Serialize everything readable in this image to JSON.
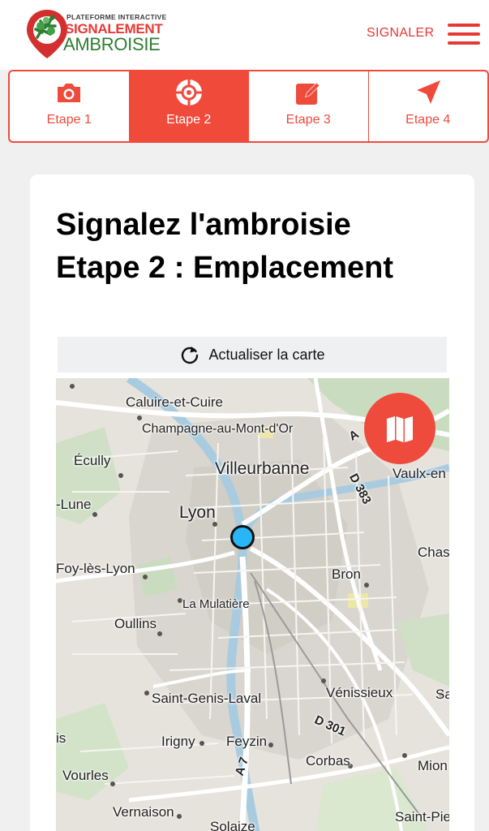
{
  "header": {
    "logo_small": "PLATEFORME INTERACTIVE",
    "logo_line1": "SIGNALEMENT",
    "logo_line2": "AMBROISIE",
    "signaler_label": "SIGNALER",
    "menu_icon": "hamburger-icon"
  },
  "steps": [
    {
      "label": "Etape 1",
      "icon": "camera-icon",
      "active": false
    },
    {
      "label": "Etape 2",
      "icon": "crosshair-icon",
      "active": true
    },
    {
      "label": "Etape 3",
      "icon": "edit-icon",
      "active": false
    },
    {
      "label": "Etape 4",
      "icon": "send-icon",
      "active": false
    }
  ],
  "card": {
    "title_line1": "Signalez l'ambroisie",
    "title_line2": "Etape 2 : Emplacement",
    "refresh_label": "Actualiser la carte"
  },
  "map": {
    "places": {
      "caluire": "Caluire-et-Cuire",
      "champagne": "Champagne-au-Mont-d'Or",
      "ecully": "Écully",
      "villeurbanne": "Villeurbanne",
      "vaulx": "Vaulx-en",
      "lune": "-Lune",
      "lyon": "Lyon",
      "d383": "D 383",
      "foy": "Foy-lès-Lyon",
      "chas": "Chas",
      "bron": "Bron",
      "mulatiere": "La Mulatière",
      "oullins": "Oullins",
      "saintgenis": "Saint-Genis-Laval",
      "venissieux": "Vénissieux",
      "sa": "Sa",
      "d301": "D 301",
      "is": "is",
      "irigny": "Irigny",
      "feyzin": "Feyzin",
      "corbas": "Corbas",
      "mion": "Mion",
      "vourles": "Vourles",
      "vernaison": "Vernaison",
      "solaize": "Solaize",
      "saintpie": "Saint-Pie",
      "a7": "A 7",
      "a": "A"
    },
    "layers_icon": "map-icon",
    "marker_color": "#29b6f6"
  },
  "colors": {
    "accent": "#ef4b3d",
    "logo_green": "#2e7d32"
  }
}
